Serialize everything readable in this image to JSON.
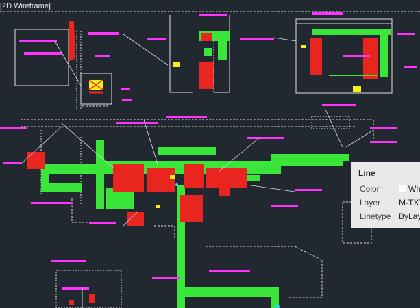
{
  "viewport": {
    "label": "[2D Wireframe]"
  },
  "tooltip": {
    "title": "Line",
    "rows": [
      {
        "key": "Color",
        "value": "Wh",
        "swatch": "#ffffff"
      },
      {
        "key": "Layer",
        "value": "M-TXT"
      },
      {
        "key": "Linetype",
        "value": "ByLay"
      }
    ]
  },
  "colors": {
    "background": "#212830",
    "duct_green": "#39e639",
    "equipment_red": "#e8261f",
    "text_magenta": "#ff33ff",
    "wall_white": "#e0e0e0",
    "leader_yellow": "#f2f21a",
    "accent_cyan": "#30d0ff"
  },
  "drawing": {
    "icons": [
      "duct-run-icon",
      "equipment-block-icon",
      "annotation-leader-icon",
      "section-view-icon"
    ]
  }
}
